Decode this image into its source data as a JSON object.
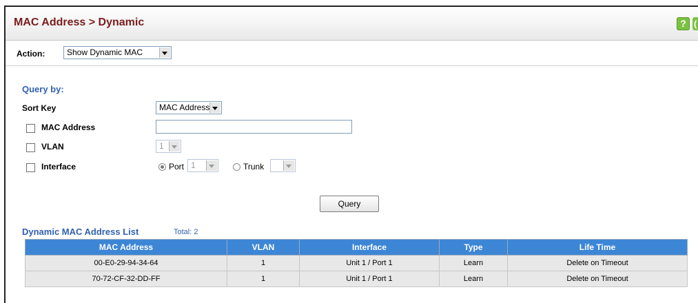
{
  "header": {
    "title": "MAC Address > Dynamic",
    "help_icon": "?"
  },
  "action": {
    "label": "Action:",
    "selected": "Show Dynamic MAC"
  },
  "query": {
    "heading": "Query by:",
    "sort_key": {
      "label": "Sort Key",
      "selected": "MAC Address"
    },
    "mac_address": {
      "label": "MAC Address",
      "value": ""
    },
    "vlan": {
      "label": "VLAN",
      "selected": "1"
    },
    "interface": {
      "label": "Interface",
      "port_label": "Port",
      "port_selected": "1",
      "trunk_label": "Trunk",
      "trunk_selected": ""
    },
    "button_label": "Query"
  },
  "list": {
    "heading": "Dynamic MAC Address List",
    "total": "Total: 2",
    "columns": [
      "MAC Address",
      "VLAN",
      "Interface",
      "Type",
      "Life Time"
    ],
    "rows": [
      [
        "00-E0-29-94-34-64",
        "1",
        "Unit 1 / Port 1",
        "Learn",
        "Delete on Timeout"
      ],
      [
        "70-72-CF-32-DD-FF",
        "1",
        "Unit 1 / Port 1",
        "Learn",
        "Delete on Timeout"
      ]
    ]
  }
}
